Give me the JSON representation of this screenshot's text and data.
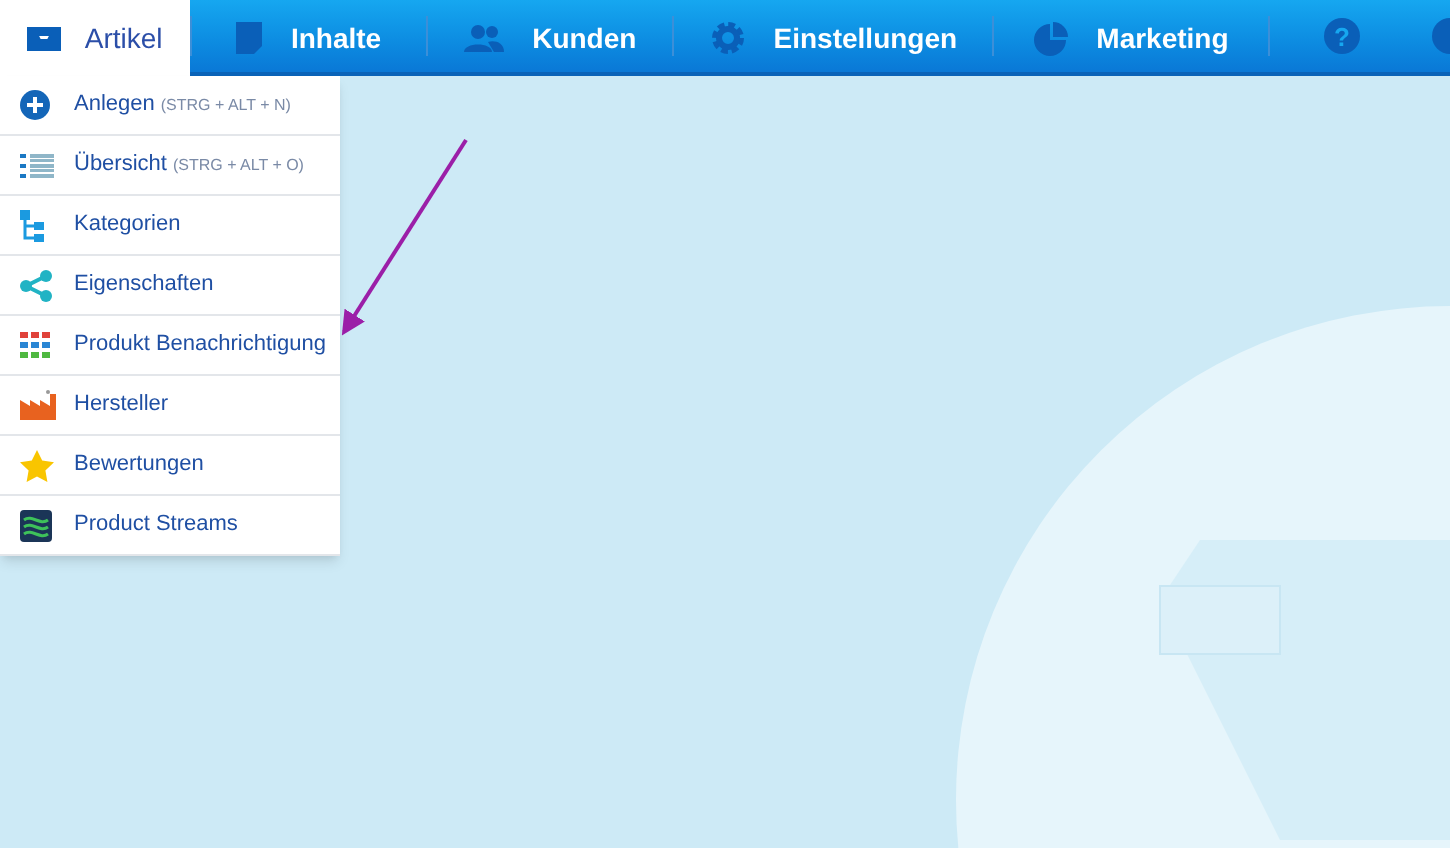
{
  "nav": {
    "tabs": [
      {
        "label": "Artikel",
        "selected": true
      },
      {
        "label": "Inhalte",
        "selected": false
      },
      {
        "label": "Kunden",
        "selected": false
      },
      {
        "label": "Einstellungen",
        "selected": false
      },
      {
        "label": "Marketing",
        "selected": false
      }
    ],
    "help": "?"
  },
  "menu": {
    "items": [
      {
        "label": "Anlegen",
        "shortcut": "(STRG + ALT + N)"
      },
      {
        "label": "Übersicht",
        "shortcut": "(STRG + ALT + O)"
      },
      {
        "label": "Kategorien"
      },
      {
        "label": "Eigenschaften"
      },
      {
        "label": "Produkt Benachrichtigung"
      },
      {
        "label": "Hersteller"
      },
      {
        "label": "Bewertungen"
      },
      {
        "label": "Product Streams"
      }
    ]
  }
}
